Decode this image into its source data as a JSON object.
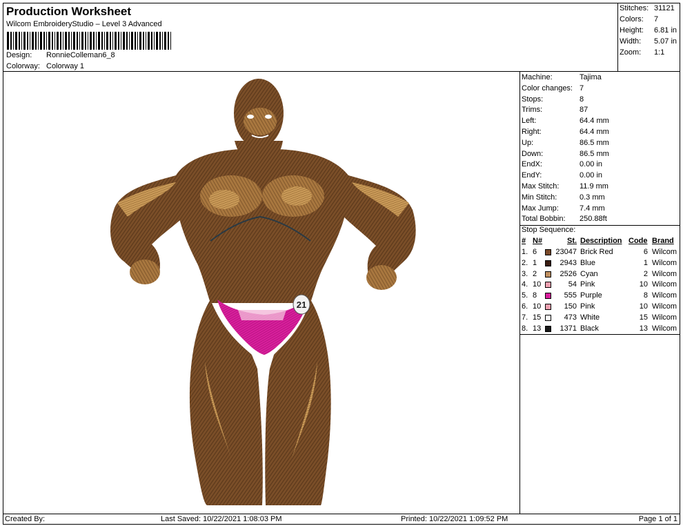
{
  "header": {
    "title": "Production Worksheet",
    "subtitle": "Wilcom EmbroideryStudio – Level 3 Advanced",
    "design_label": "Design:",
    "design_value": "RonnieColleman6_8",
    "colorway_label": "Colorway:",
    "colorway_value": "Colorway 1"
  },
  "stats": [
    {
      "label": "Stitches:",
      "value": "31121"
    },
    {
      "label": "Colors:",
      "value": "7"
    },
    {
      "label": "Height:",
      "value": "6.81 in"
    },
    {
      "label": "Width:",
      "value": "5.07 in"
    },
    {
      "label": "Zoom:",
      "value": "1:1"
    }
  ],
  "machine_info": [
    {
      "label": "Machine:",
      "value": "Tajima"
    },
    {
      "label": "Color changes:",
      "value": "7"
    },
    {
      "label": "Stops:",
      "value": "8"
    },
    {
      "label": "Trims:",
      "value": "87"
    },
    {
      "label": "Left:",
      "value": "64.4 mm"
    },
    {
      "label": "Right:",
      "value": "64.4 mm"
    },
    {
      "label": "Up:",
      "value": "86.5 mm"
    },
    {
      "label": "Down:",
      "value": "86.5 mm"
    },
    {
      "label": "EndX:",
      "value": "0.00 in"
    },
    {
      "label": "EndY:",
      "value": "0.00 in"
    },
    {
      "label": "Max Stitch:",
      "value": "11.9 mm"
    },
    {
      "label": "Min Stitch:",
      "value": "0.3 mm"
    },
    {
      "label": "Max Jump:",
      "value": "7.4 mm"
    },
    {
      "label": "Total Bobbin:",
      "value": "250.88ft"
    }
  ],
  "stop_sequence": {
    "title": "Stop Sequence:",
    "headers": {
      "num": "#",
      "n": "N#",
      "st": "St.",
      "desc": "Description",
      "code": "Code",
      "brand": "Brand"
    },
    "rows": [
      {
        "num": "1.",
        "n": "6",
        "color": "#7a4a2b",
        "st": "23047",
        "desc": "Brick Red",
        "code": "6",
        "brand": "Wilcom"
      },
      {
        "num": "2.",
        "n": "1",
        "color": "#3a1c10",
        "st": "2943",
        "desc": "Blue",
        "code": "1",
        "brand": "Wilcom"
      },
      {
        "num": "3.",
        "n": "2",
        "color": "#c09060",
        "st": "2526",
        "desc": "Cyan",
        "code": "2",
        "brand": "Wilcom"
      },
      {
        "num": "4.",
        "n": "10",
        "color": "#f0a0b0",
        "st": "54",
        "desc": "Pink",
        "code": "10",
        "brand": "Wilcom"
      },
      {
        "num": "5.",
        "n": "8",
        "color": "#d81e9c",
        "st": "555",
        "desc": "Purple",
        "code": "8",
        "brand": "Wilcom"
      },
      {
        "num": "6.",
        "n": "10",
        "color": "#f0a0b0",
        "st": "150",
        "desc": "Pink",
        "code": "10",
        "brand": "Wilcom"
      },
      {
        "num": "7.",
        "n": "15",
        "color": "#ffffff",
        "st": "473",
        "desc": "White",
        "code": "15",
        "brand": "Wilcom"
      },
      {
        "num": "8.",
        "n": "13",
        "color": "#1a1a1a",
        "st": "1371",
        "desc": "Black",
        "code": "13",
        "brand": "Wilcom"
      }
    ]
  },
  "design_badge": "21",
  "footer": {
    "created_by": "Created By:",
    "last_saved": "Last Saved: 10/22/2021 1:08:03 PM",
    "printed": "Printed: 10/22/2021 1:09:52 PM",
    "page": "Page 1 of 1"
  },
  "colors": {
    "skin_dark": "#5a3a1e",
    "skin_mid": "#8a5a30",
    "skin_light": "#b98a4e",
    "trunks": "#d81e9c"
  }
}
